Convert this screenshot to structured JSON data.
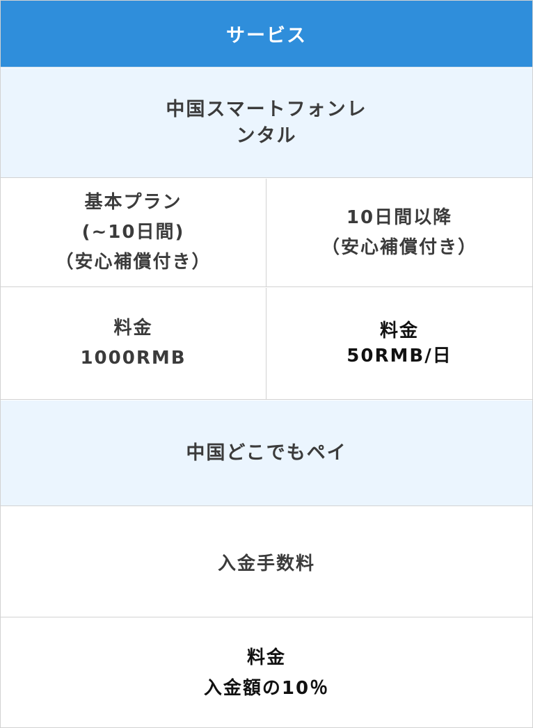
{
  "header": {
    "title": "サービス"
  },
  "sections": [
    {
      "title_lines": [
        "中国スマートフォンレ",
        "ンタル"
      ],
      "rows": [
        {
          "left_lines": [
            "基本プラン",
            "(~10日間)",
            "（安心補償付き）"
          ],
          "right_lines": [
            "10日間以降",
            "（安心補償付き）"
          ]
        },
        {
          "left_lines": [
            "料金",
            "1000RMB"
          ],
          "right_lines": [
            "料金",
            "50RMB/日"
          ]
        }
      ]
    },
    {
      "title_lines": [
        "中国どこでもペイ"
      ],
      "rows": [
        {
          "full_lines": [
            "入金手数料"
          ]
        },
        {
          "full_lines": [
            "料金",
            "入金額の10％"
          ]
        }
      ]
    }
  ],
  "colors": {
    "header_bg": "#2f8edb",
    "section_bg": "#ebf5fe",
    "border": "#d2d2d2",
    "text": "#3b3b3b"
  }
}
